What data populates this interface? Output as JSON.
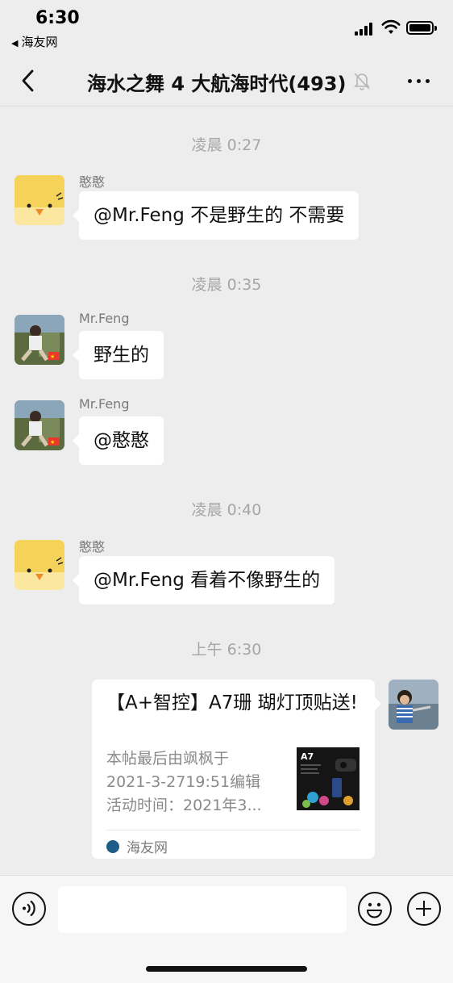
{
  "status_bar": {
    "time": "6:30",
    "back_app": "海友网",
    "icons": [
      "signal-icon",
      "wifi-icon",
      "battery-icon"
    ]
  },
  "nav": {
    "title": "海水之舞 4 大航海时代(493)",
    "icons": [
      "back-arrow-icon",
      "mute-bell-icon",
      "more-dots-icon"
    ]
  },
  "messages": [
    {
      "timestamp": "凌晨 0:27",
      "sender": "憨憨",
      "text": "@Mr.Feng 不是野生的 不需要"
    },
    {
      "timestamp": "凌晨 0:35",
      "sender": "Mr.Feng",
      "text": "野生的"
    },
    {
      "sender": "Mr.Feng",
      "text": "@憨憨"
    },
    {
      "timestamp": "凌晨 0:40",
      "sender": "憨憨",
      "text": "@Mr.Feng 看着不像野生的"
    }
  ],
  "link_card": {
    "timestamp": "上午 6:30",
    "title": "【A+智控】A7珊 瑚灯顶贴送!",
    "desc_lines": [
      "本帖最后由飒枫于",
      "2021-3-2719:51编辑",
      "活动时间：2021年3..."
    ],
    "thumb_label": "A7",
    "source": "海友网"
  },
  "input_bar": {
    "placeholder": "",
    "icons": [
      "voice-icon",
      "emoji-icon",
      "plus-icon"
    ]
  },
  "colors": {
    "background": "#ededed",
    "bubble": "#ffffff",
    "timestamp": "#a6a6a6"
  }
}
